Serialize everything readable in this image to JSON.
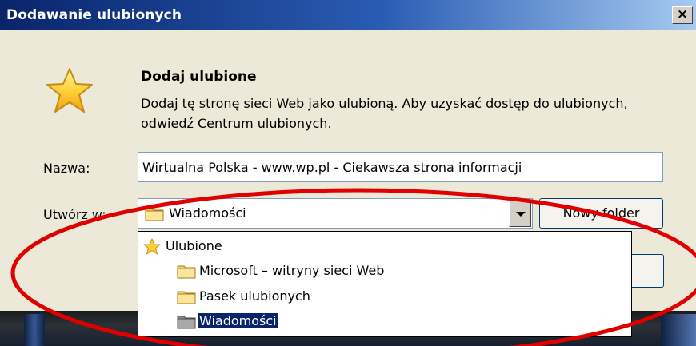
{
  "window": {
    "title": "Dodawanie ulubionych",
    "close_label": "×"
  },
  "header": {
    "icon": "star-icon",
    "heading": "Dodaj ulubione",
    "description": "Dodaj tę stronę sieci Web jako ulubioną. Aby uzyskać dostęp do ulubionych, odwiedź Centrum ulubionych."
  },
  "form": {
    "name_label": "Nazwa:",
    "name_value": "Wirtualna Polska - www.wp.pl - Ciekawsza strona informacji",
    "create_in_label": "Utwórz w:",
    "create_in_value": "Wiadomości",
    "new_folder_label": "Nowy folder"
  },
  "dropdown": {
    "items": [
      {
        "label": "Ulubione",
        "icon": "star-icon",
        "level": 0
      },
      {
        "label": "Microsoft – witryny sieci Web",
        "icon": "folder-icon",
        "level": 1
      },
      {
        "label": "Pasek ulubionych",
        "icon": "folder-icon",
        "level": 1
      },
      {
        "label": "Wiadomości",
        "icon": "folder-icon",
        "level": 1,
        "selected": true
      }
    ]
  },
  "colors": {
    "titlebar": "#0a246a",
    "selection": "#0a246a",
    "annotation": "#e00000"
  }
}
